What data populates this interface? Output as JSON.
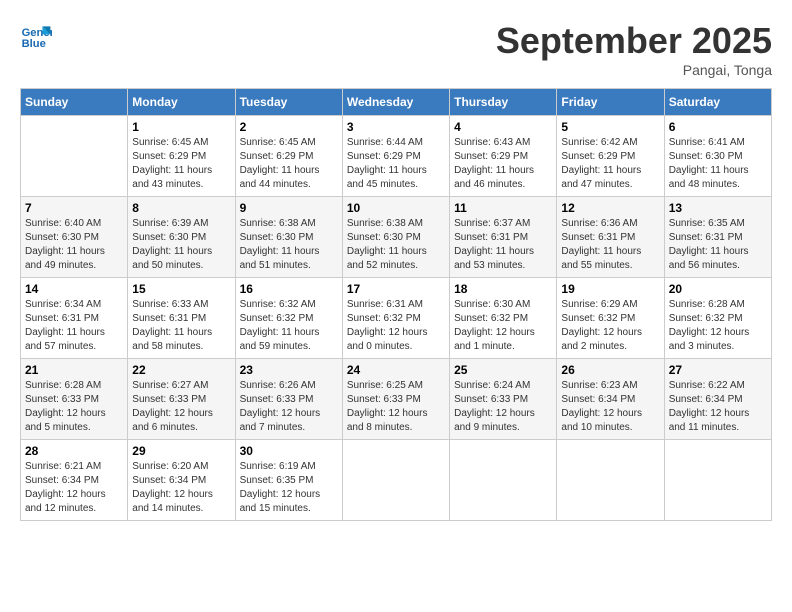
{
  "logo": {
    "line1": "General",
    "line2": "Blue"
  },
  "title": "September 2025",
  "location": "Pangai, Tonga",
  "days_header": [
    "Sunday",
    "Monday",
    "Tuesday",
    "Wednesday",
    "Thursday",
    "Friday",
    "Saturday"
  ],
  "weeks": [
    [
      {
        "day": "",
        "sunrise": "",
        "sunset": "",
        "daylight": ""
      },
      {
        "day": "1",
        "sunrise": "Sunrise: 6:45 AM",
        "sunset": "Sunset: 6:29 PM",
        "daylight": "Daylight: 11 hours and 43 minutes."
      },
      {
        "day": "2",
        "sunrise": "Sunrise: 6:45 AM",
        "sunset": "Sunset: 6:29 PM",
        "daylight": "Daylight: 11 hours and 44 minutes."
      },
      {
        "day": "3",
        "sunrise": "Sunrise: 6:44 AM",
        "sunset": "Sunset: 6:29 PM",
        "daylight": "Daylight: 11 hours and 45 minutes."
      },
      {
        "day": "4",
        "sunrise": "Sunrise: 6:43 AM",
        "sunset": "Sunset: 6:29 PM",
        "daylight": "Daylight: 11 hours and 46 minutes."
      },
      {
        "day": "5",
        "sunrise": "Sunrise: 6:42 AM",
        "sunset": "Sunset: 6:29 PM",
        "daylight": "Daylight: 11 hours and 47 minutes."
      },
      {
        "day": "6",
        "sunrise": "Sunrise: 6:41 AM",
        "sunset": "Sunset: 6:30 PM",
        "daylight": "Daylight: 11 hours and 48 minutes."
      }
    ],
    [
      {
        "day": "7",
        "sunrise": "Sunrise: 6:40 AM",
        "sunset": "Sunset: 6:30 PM",
        "daylight": "Daylight: 11 hours and 49 minutes."
      },
      {
        "day": "8",
        "sunrise": "Sunrise: 6:39 AM",
        "sunset": "Sunset: 6:30 PM",
        "daylight": "Daylight: 11 hours and 50 minutes."
      },
      {
        "day": "9",
        "sunrise": "Sunrise: 6:38 AM",
        "sunset": "Sunset: 6:30 PM",
        "daylight": "Daylight: 11 hours and 51 minutes."
      },
      {
        "day": "10",
        "sunrise": "Sunrise: 6:38 AM",
        "sunset": "Sunset: 6:30 PM",
        "daylight": "Daylight: 11 hours and 52 minutes."
      },
      {
        "day": "11",
        "sunrise": "Sunrise: 6:37 AM",
        "sunset": "Sunset: 6:31 PM",
        "daylight": "Daylight: 11 hours and 53 minutes."
      },
      {
        "day": "12",
        "sunrise": "Sunrise: 6:36 AM",
        "sunset": "Sunset: 6:31 PM",
        "daylight": "Daylight: 11 hours and 55 minutes."
      },
      {
        "day": "13",
        "sunrise": "Sunrise: 6:35 AM",
        "sunset": "Sunset: 6:31 PM",
        "daylight": "Daylight: 11 hours and 56 minutes."
      }
    ],
    [
      {
        "day": "14",
        "sunrise": "Sunrise: 6:34 AM",
        "sunset": "Sunset: 6:31 PM",
        "daylight": "Daylight: 11 hours and 57 minutes."
      },
      {
        "day": "15",
        "sunrise": "Sunrise: 6:33 AM",
        "sunset": "Sunset: 6:31 PM",
        "daylight": "Daylight: 11 hours and 58 minutes."
      },
      {
        "day": "16",
        "sunrise": "Sunrise: 6:32 AM",
        "sunset": "Sunset: 6:32 PM",
        "daylight": "Daylight: 11 hours and 59 minutes."
      },
      {
        "day": "17",
        "sunrise": "Sunrise: 6:31 AM",
        "sunset": "Sunset: 6:32 PM",
        "daylight": "Daylight: 12 hours and 0 minutes."
      },
      {
        "day": "18",
        "sunrise": "Sunrise: 6:30 AM",
        "sunset": "Sunset: 6:32 PM",
        "daylight": "Daylight: 12 hours and 1 minute."
      },
      {
        "day": "19",
        "sunrise": "Sunrise: 6:29 AM",
        "sunset": "Sunset: 6:32 PM",
        "daylight": "Daylight: 12 hours and 2 minutes."
      },
      {
        "day": "20",
        "sunrise": "Sunrise: 6:28 AM",
        "sunset": "Sunset: 6:32 PM",
        "daylight": "Daylight: 12 hours and 3 minutes."
      }
    ],
    [
      {
        "day": "21",
        "sunrise": "Sunrise: 6:28 AM",
        "sunset": "Sunset: 6:33 PM",
        "daylight": "Daylight: 12 hours and 5 minutes."
      },
      {
        "day": "22",
        "sunrise": "Sunrise: 6:27 AM",
        "sunset": "Sunset: 6:33 PM",
        "daylight": "Daylight: 12 hours and 6 minutes."
      },
      {
        "day": "23",
        "sunrise": "Sunrise: 6:26 AM",
        "sunset": "Sunset: 6:33 PM",
        "daylight": "Daylight: 12 hours and 7 minutes."
      },
      {
        "day": "24",
        "sunrise": "Sunrise: 6:25 AM",
        "sunset": "Sunset: 6:33 PM",
        "daylight": "Daylight: 12 hours and 8 minutes."
      },
      {
        "day": "25",
        "sunrise": "Sunrise: 6:24 AM",
        "sunset": "Sunset: 6:33 PM",
        "daylight": "Daylight: 12 hours and 9 minutes."
      },
      {
        "day": "26",
        "sunrise": "Sunrise: 6:23 AM",
        "sunset": "Sunset: 6:34 PM",
        "daylight": "Daylight: 12 hours and 10 minutes."
      },
      {
        "day": "27",
        "sunrise": "Sunrise: 6:22 AM",
        "sunset": "Sunset: 6:34 PM",
        "daylight": "Daylight: 12 hours and 11 minutes."
      }
    ],
    [
      {
        "day": "28",
        "sunrise": "Sunrise: 6:21 AM",
        "sunset": "Sunset: 6:34 PM",
        "daylight": "Daylight: 12 hours and 12 minutes."
      },
      {
        "day": "29",
        "sunrise": "Sunrise: 6:20 AM",
        "sunset": "Sunset: 6:34 PM",
        "daylight": "Daylight: 12 hours and 14 minutes."
      },
      {
        "day": "30",
        "sunrise": "Sunrise: 6:19 AM",
        "sunset": "Sunset: 6:35 PM",
        "daylight": "Daylight: 12 hours and 15 minutes."
      },
      {
        "day": "",
        "sunrise": "",
        "sunset": "",
        "daylight": ""
      },
      {
        "day": "",
        "sunrise": "",
        "sunset": "",
        "daylight": ""
      },
      {
        "day": "",
        "sunrise": "",
        "sunset": "",
        "daylight": ""
      },
      {
        "day": "",
        "sunrise": "",
        "sunset": "",
        "daylight": ""
      }
    ]
  ]
}
